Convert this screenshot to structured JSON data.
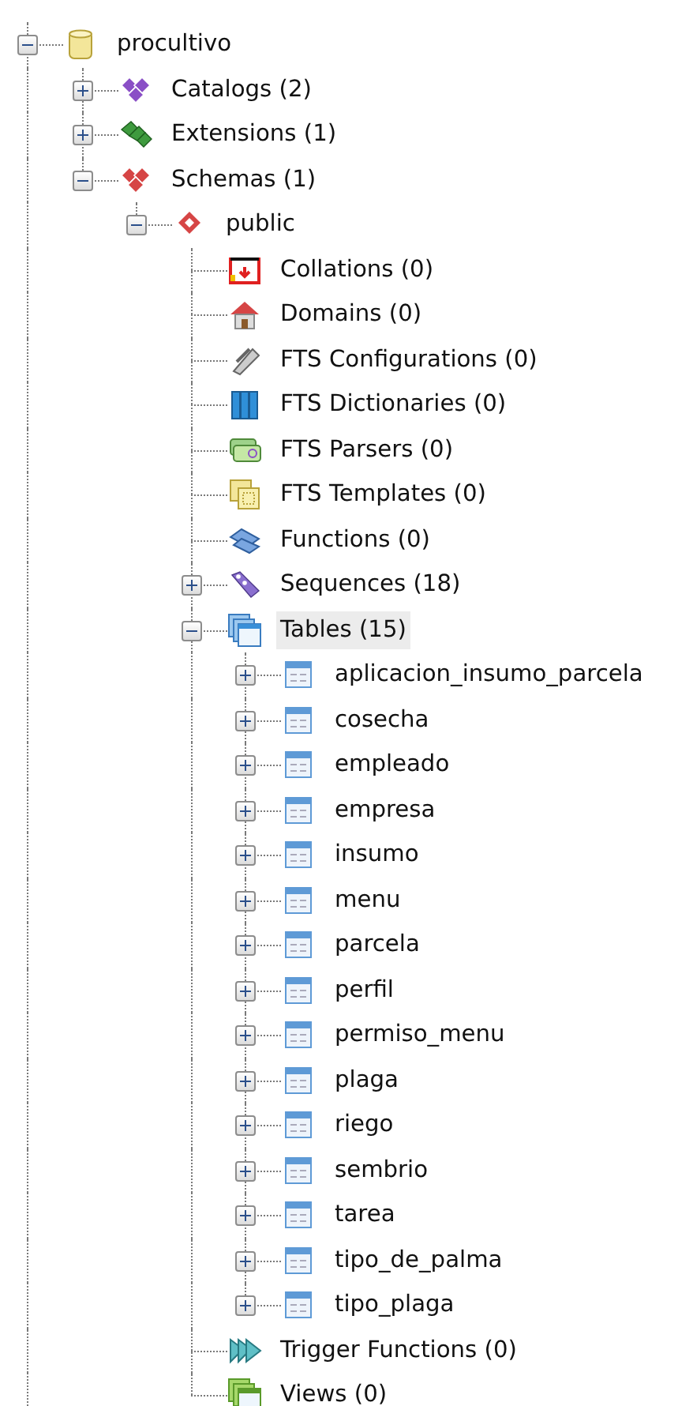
{
  "tree": {
    "label": "procultivo",
    "kind": "database",
    "expanded": true,
    "selected": false,
    "children": [
      {
        "label": "Catalogs (2)",
        "kind": "catalogs",
        "expanded": false,
        "selected": false
      },
      {
        "label": "Extensions (1)",
        "kind": "extensions",
        "expanded": false,
        "selected": false
      },
      {
        "label": "Schemas (1)",
        "kind": "schemas",
        "expanded": true,
        "selected": false,
        "children": [
          {
            "label": "public",
            "kind": "schema",
            "expanded": true,
            "selected": false,
            "children": [
              {
                "label": "Collations (0)",
                "kind": "collations",
                "selected": false
              },
              {
                "label": "Domains (0)",
                "kind": "domains",
                "selected": false
              },
              {
                "label": "FTS Configurations (0)",
                "kind": "fts_configurations",
                "selected": false
              },
              {
                "label": "FTS Dictionaries (0)",
                "kind": "fts_dictionaries",
                "selected": false
              },
              {
                "label": "FTS Parsers (0)",
                "kind": "fts_parsers",
                "selected": false
              },
              {
                "label": "FTS Templates (0)",
                "kind": "fts_templates",
                "selected": false
              },
              {
                "label": "Functions (0)",
                "kind": "functions",
                "selected": false
              },
              {
                "label": "Sequences (18)",
                "kind": "sequences",
                "expanded": false,
                "selected": false
              },
              {
                "label": "Tables (15)",
                "kind": "tables",
                "expanded": true,
                "selected": true,
                "children": [
                  {
                    "label": "aplicacion_insumo_parcela",
                    "kind": "table",
                    "expanded": false,
                    "selected": false
                  },
                  {
                    "label": "cosecha",
                    "kind": "table",
                    "expanded": false,
                    "selected": false
                  },
                  {
                    "label": "empleado",
                    "kind": "table",
                    "expanded": false,
                    "selected": false
                  },
                  {
                    "label": "empresa",
                    "kind": "table",
                    "expanded": false,
                    "selected": false
                  },
                  {
                    "label": "insumo",
                    "kind": "table",
                    "expanded": false,
                    "selected": false
                  },
                  {
                    "label": "menu",
                    "kind": "table",
                    "expanded": false,
                    "selected": false
                  },
                  {
                    "label": "parcela",
                    "kind": "table",
                    "expanded": false,
                    "selected": false
                  },
                  {
                    "label": "perfil",
                    "kind": "table",
                    "expanded": false,
                    "selected": false
                  },
                  {
                    "label": "permiso_menu",
                    "kind": "table",
                    "expanded": false,
                    "selected": false
                  },
                  {
                    "label": "plaga",
                    "kind": "table",
                    "expanded": false,
                    "selected": false
                  },
                  {
                    "label": "riego",
                    "kind": "table",
                    "expanded": false,
                    "selected": false
                  },
                  {
                    "label": "sembrio",
                    "kind": "table",
                    "expanded": false,
                    "selected": false
                  },
                  {
                    "label": "tarea",
                    "kind": "table",
                    "expanded": false,
                    "selected": false
                  },
                  {
                    "label": "tipo_de_palma",
                    "kind": "table",
                    "expanded": false,
                    "selected": false
                  },
                  {
                    "label": "tipo_plaga",
                    "kind": "table",
                    "expanded": false,
                    "selected": false
                  }
                ]
              },
              {
                "label": "Trigger Functions (0)",
                "kind": "trigger_functions",
                "selected": false
              },
              {
                "label": "Views (0)",
                "kind": "views",
                "selected": false
              }
            ]
          }
        ]
      }
    ]
  }
}
